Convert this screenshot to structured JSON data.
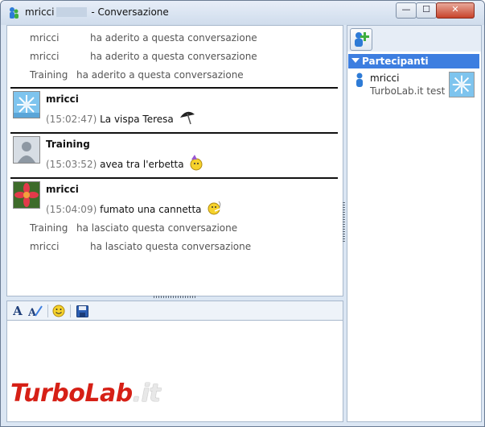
{
  "window": {
    "title_user": "mricci",
    "title_suffix": "- Conversazione",
    "btn_min": "—",
    "btn_max": "☐",
    "btn_close": "✕"
  },
  "chat": {
    "system_top": [
      {
        "who": "mricci",
        "text": "ha aderito a questa conversazione"
      },
      {
        "who": "mricci",
        "text": "ha aderito a questa conversazione"
      },
      {
        "who": "Training",
        "text": "ha aderito a questa conversazione"
      }
    ],
    "messages": [
      {
        "sender": "mricci",
        "time": "(15:02:47)",
        "text": "La vispa Teresa",
        "emoticon": "umbrella-icon"
      },
      {
        "sender": "Training",
        "time": "(15:03:52)",
        "text": "avea tra l'erbetta",
        "emoticon": "party-icon"
      },
      {
        "sender": "mricci",
        "time": "(15:04:09)",
        "text": "fumato una cannetta",
        "emoticon": "smoking-smiley-icon"
      }
    ],
    "system_bottom": [
      {
        "who": "Training",
        "text": "ha lasciato questa conversazione"
      },
      {
        "who": "mricci",
        "text": "ha lasciato questa conversazione"
      }
    ]
  },
  "toolbar": {
    "font_icon": "A",
    "icons": [
      "font-icon",
      "font-color-icon",
      "emoticon-icon",
      "save-icon"
    ]
  },
  "participants": {
    "header": "Partecipanti",
    "items": [
      {
        "name": "mricci",
        "status": "TurboLab.it test"
      }
    ]
  },
  "watermark": {
    "part1": "TurboLab",
    "part2": ".it"
  },
  "colors": {
    "accent": "#3d7ee0",
    "time": "#777777",
    "watermark_red": "#d62016"
  }
}
